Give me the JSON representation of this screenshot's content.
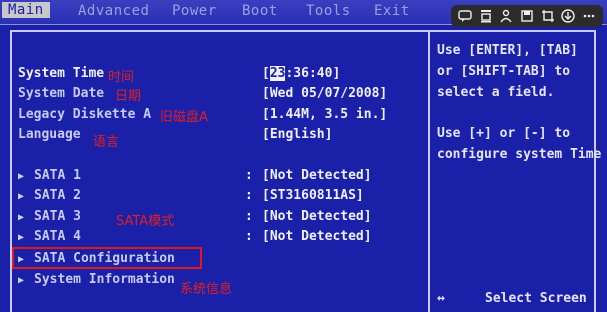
{
  "menu": [
    "Main",
    "Advanced",
    "Power",
    "Boot",
    "Tools",
    "Exit"
  ],
  "settings": [
    {
      "label": "System Time",
      "value": ":36:40]",
      "value_prefix": "[",
      "cursor": "23",
      "note": "时间"
    },
    {
      "label": "System Date",
      "value": "[Wed 05/07/2008]",
      "note": "日期"
    },
    {
      "label": "Legacy Diskette A",
      "value": "[1.44M, 3.5 in.]",
      "note": "旧磁盘A"
    },
    {
      "label": "Language",
      "value": "[English]",
      "note": "语言"
    }
  ],
  "sata": [
    {
      "label": "SATA 1",
      "value": "[Not Detected]"
    },
    {
      "label": "SATA 2",
      "value": "[ST3160811AS]"
    },
    {
      "label": "SATA 3",
      "value": "[Not Detected]"
    },
    {
      "label": "SATA 4",
      "value": "[Not Detected]"
    }
  ],
  "sata_note": "SATA模式",
  "submenus": [
    {
      "label": "SATA Configuration"
    },
    {
      "label": "System Information",
      "note": "系统信息"
    }
  ],
  "help": {
    "line1": "Use [ENTER], [TAB]",
    "line2": "or [SHIFT-TAB] to",
    "line3": "select a field.",
    "line4": "Use [+] or [-] to",
    "line5": "configure system Time",
    "nav_symbol": "↔",
    "nav_text": "Select Screen"
  },
  "colon": ":",
  "toolbar_icons": [
    "comment-icon",
    "stamp-icon",
    "person-icon",
    "save-icon",
    "crop-icon",
    "download-icon",
    "more-icon"
  ],
  "colors": {
    "bios_blue": "#1a20a8",
    "annotation_red": "#e02020"
  }
}
